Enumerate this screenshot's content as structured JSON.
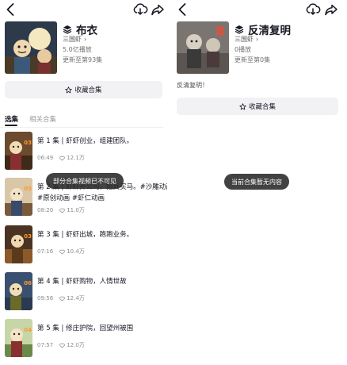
{
  "left_panel": {
    "title": "布衣",
    "author": "三国虾",
    "plays": "5.0亿播放",
    "update_status": "更新至第93集",
    "collect_label": "收藏合集",
    "tabs": [
      "选集",
      "相关合集"
    ],
    "toast": "部分合集视频已不可见",
    "episodes": [
      {
        "badge": "03",
        "title": "第 1 集 | 虾虾创业，组建团队。",
        "title2": "",
        "duration": "06:49",
        "likes": "12.1万"
      },
      {
        "badge": "05",
        "title": "第 2 集 | 虾虾开公司，招兵买马。#沙雕动画",
        "title2": "#原创动画 #虾仁动画",
        "duration": "08:20",
        "likes": "11.0万"
      },
      {
        "badge": "03",
        "title": "第 3 集 | 虾虾出城，跑跑业务。",
        "title2": "",
        "duration": "07:16",
        "likes": "10.4万"
      },
      {
        "badge": "06",
        "title": "第 4 集 | 虾虾购物，人情世故",
        "title2": "",
        "duration": "09:56",
        "likes": "12.4万"
      },
      {
        "badge": "04",
        "title": "第 5 集 | 修庄护院，回望州被围",
        "title2": "",
        "duration": "07:57",
        "likes": "12.0万"
      }
    ]
  },
  "right_panel": {
    "title": "反清复明",
    "author": "三国虾",
    "plays": "0播放",
    "update_status": "更新至第0集",
    "description": "反清复明！",
    "collect_label": "收藏合集",
    "toast": "当前合集暂无内容"
  },
  "icons": {
    "back": "chevron-left-icon",
    "download": "cloud-download-icon",
    "share": "share-arrow-icon",
    "collection": "stack-layers-icon",
    "star": "star-outline-icon",
    "heart": "heart-outline-icon"
  },
  "colors": {
    "badge_orange": "#ff9a2a",
    "button_bg": "#f2f2f4",
    "toast_bg": "#282828"
  }
}
